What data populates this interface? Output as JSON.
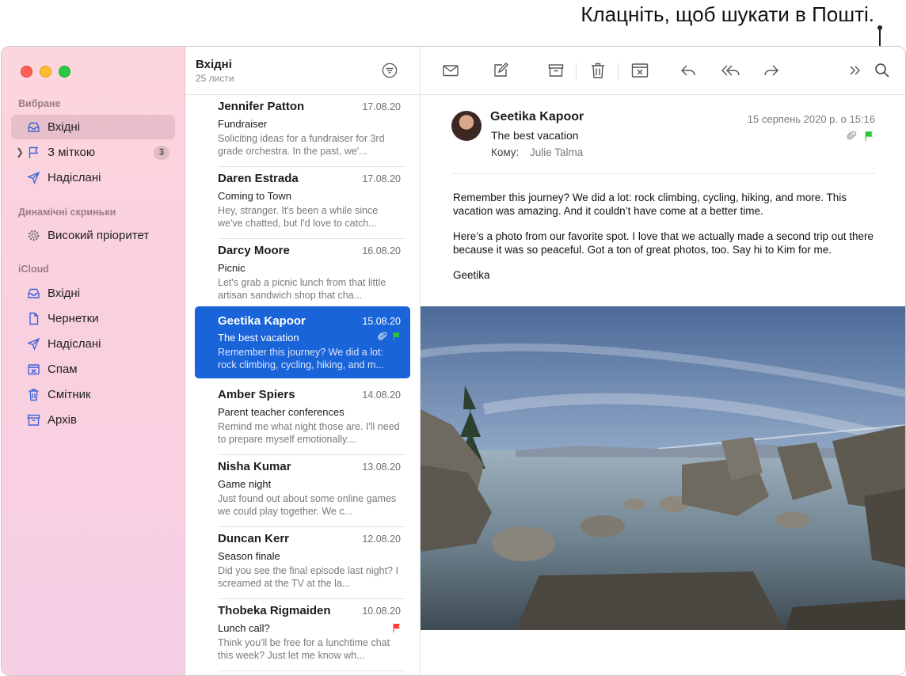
{
  "callout": "Клацніть, щоб шукати в Пошті.",
  "sidebar": {
    "sections": [
      {
        "title": "Вибране"
      },
      {
        "title": "Динамічні скриньки"
      },
      {
        "title": "iCloud"
      }
    ],
    "items": [
      {
        "label": "Вхідні",
        "icon": "inbox-icon"
      },
      {
        "label": "З міткою",
        "icon": "flag-icon",
        "badge": "3"
      },
      {
        "label": "Надіслані",
        "icon": "sent-icon"
      },
      {
        "label": "Високий пріоритет",
        "icon": "gear-icon"
      },
      {
        "label": "Вхідні",
        "icon": "inbox-icon"
      },
      {
        "label": "Чернетки",
        "icon": "draft-icon"
      },
      {
        "label": "Надіслані",
        "icon": "sent-icon"
      },
      {
        "label": "Спам",
        "icon": "junk-icon"
      },
      {
        "label": "Смітник",
        "icon": "trash-icon"
      },
      {
        "label": "Архів",
        "icon": "archive-icon"
      }
    ]
  },
  "list": {
    "title": "Вхідні",
    "count": "25 листи",
    "messages": [
      {
        "from": "Jennifer Patton",
        "date": "17.08.20",
        "subject": "Fundraiser",
        "preview": "Soliciting ideas for a fundraiser for 3rd grade orchestra. In the past, we'..."
      },
      {
        "from": "Daren Estrada",
        "date": "17.08.20",
        "subject": "Coming to Town",
        "preview": "Hey, stranger. It's been a while since we've chatted, but I'd love to catch..."
      },
      {
        "from": "Darcy Moore",
        "date": "16.08.20",
        "subject": "Picnic",
        "preview": "Let's grab a picnic lunch from that little artisan sandwich shop that cha..."
      },
      {
        "from": "Geetika Kapoor",
        "date": "15.08.20",
        "subject": "The best vacation",
        "preview": "Remember this journey? We did a lot: rock climbing, cycling, hiking, and m..."
      },
      {
        "from": "Amber Spiers",
        "date": "14.08.20",
        "subject": "Parent teacher conferences",
        "preview": "Remind me what night those are. I'll need to prepare myself emotionally...."
      },
      {
        "from": "Nisha Kumar",
        "date": "13.08.20",
        "subject": "Game night",
        "preview": "Just found out about some online games we could play together. We c..."
      },
      {
        "from": "Duncan Kerr",
        "date": "12.08.20",
        "subject": "Season finale",
        "preview": "Did you see the final episode last night? I screamed at the TV at the la..."
      },
      {
        "from": "Thobeka Rigmaiden",
        "date": "10.08.20",
        "subject": "Lunch call?",
        "preview": "Think you'll be free for a lunchtime chat this week? Just let me know wh..."
      }
    ]
  },
  "message": {
    "from": "Geetika Kapoor",
    "subject": "The best vacation",
    "to_label": "Кому:",
    "to": "Julie Talma",
    "date": "15 серпень 2020 р. о 15:16",
    "body": [
      "Remember this journey? We did a lot: rock climbing, cycling, hiking, and more. This vacation was amazing. And it couldn’t have come at a better time.",
      "Here’s a photo from our favorite spot. I love that we actually made a second trip out there because it was so peaceful. Got a ton of great photos, too. Say hi to Kim for me.",
      "Geetika"
    ]
  },
  "colors": {
    "selection": "#1964d9",
    "flag_green": "#2cc33a",
    "flag_red": "#ff3b30",
    "sidebar_icon": "#3f63d8"
  }
}
